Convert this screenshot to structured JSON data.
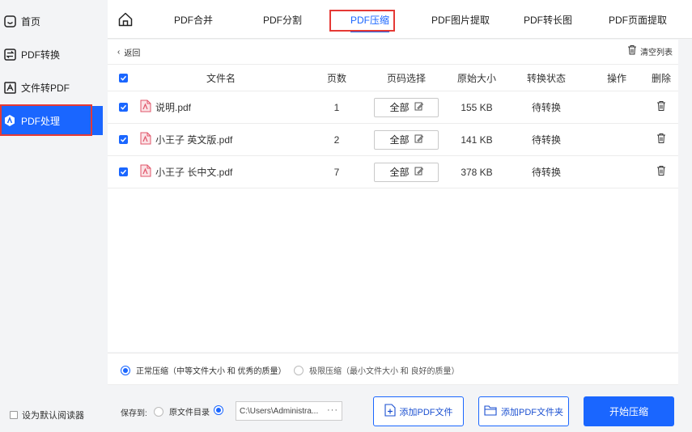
{
  "sidebar": {
    "items": [
      {
        "label": "首页",
        "icon": "home-icon"
      },
      {
        "label": "PDF转换",
        "icon": "convert-icon"
      },
      {
        "label": "文件转PDF",
        "icon": "file-to-pdf-icon"
      },
      {
        "label": "PDF处理",
        "icon": "pdf-process-icon",
        "active": true
      }
    ],
    "default_reader_label": "设为默认阅读器"
  },
  "tabs": [
    {
      "label": "PDF合并"
    },
    {
      "label": "PDF分割"
    },
    {
      "label": "PDF压缩",
      "active": true
    },
    {
      "label": "PDF图片提取"
    },
    {
      "label": "PDF转长图"
    },
    {
      "label": "PDF页面提取"
    }
  ],
  "main": {
    "back_label": "返回",
    "clear_label": "清空列表",
    "columns": [
      "文件名",
      "页数",
      "页码选择",
      "原始大小",
      "转换状态",
      "操作",
      "删除"
    ],
    "rows": [
      {
        "name": "说明.pdf",
        "pages": "1",
        "range": "全部",
        "size": "155 KB",
        "status": "待转换"
      },
      {
        "name": "小王子 英文版.pdf",
        "pages": "2",
        "range": "全部",
        "size": "141 KB",
        "status": "待转换"
      },
      {
        "name": "小王子 长中文.pdf",
        "pages": "7",
        "range": "全部",
        "size": "378 KB",
        "status": "待转换"
      }
    ]
  },
  "compression": {
    "normal_label": "正常压缩（中等文件大小 和 优秀的质量）",
    "extreme_label": "极限压缩（最小文件大小 和 良好的质量）",
    "selected": "normal"
  },
  "bottom": {
    "save_to_label": "保存到:",
    "original_dir_label": "原文件目录",
    "path_value": "C:\\Users\\Administra...",
    "add_file_label": "添加PDF文件",
    "add_folder_label": "添加PDF文件夹",
    "start_label": "开始压缩"
  },
  "colors": {
    "accent": "#1a66ff",
    "highlight_box": "#e53935"
  }
}
